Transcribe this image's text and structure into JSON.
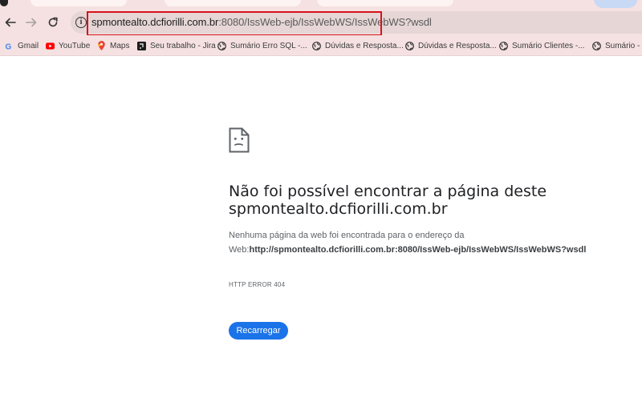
{
  "browser": {
    "url_host": "spmontealto.dcfiorilli.com.br",
    "url_path": ":8080/IssWeb-ejb/IssWebWS/IssWebWS?wsdl"
  },
  "bookmarks": [
    {
      "label": "Gmail",
      "icon": "gmail-icon"
    },
    {
      "label": "YouTube",
      "icon": "youtube-icon"
    },
    {
      "label": "Maps",
      "icon": "maps-icon"
    },
    {
      "label": "Seu trabalho - Jira",
      "icon": "jira-icon"
    },
    {
      "label": "Sumário Erro SQL -...",
      "icon": "globe-icon"
    },
    {
      "label": "Dúvidas e Resposta...",
      "icon": "globe-icon"
    },
    {
      "label": "Dúvidas e Resposta...",
      "icon": "globe-icon"
    },
    {
      "label": "Sumário Clientes -...",
      "icon": "globe-icon"
    },
    {
      "label": "Sumário - D",
      "icon": "globe-icon"
    }
  ],
  "error": {
    "title": "Não foi possível encontrar a página deste spmontealto.dcfiorilli.com.br",
    "body_prefix": "Nenhuma página da web foi encontrada para o endereço da Web:",
    "body_url": "http://spmontealto.dcfiorilli.com.br:8080/IssWeb-ejb/IssWebWS/IssWebWS?wsdl",
    "code": "HTTP ERROR 404",
    "reload_label": "Recarregar"
  },
  "colors": {
    "accent": "#1a73e8",
    "highlight": "#d6131b",
    "chrome_frame": "#f5e1e1"
  }
}
